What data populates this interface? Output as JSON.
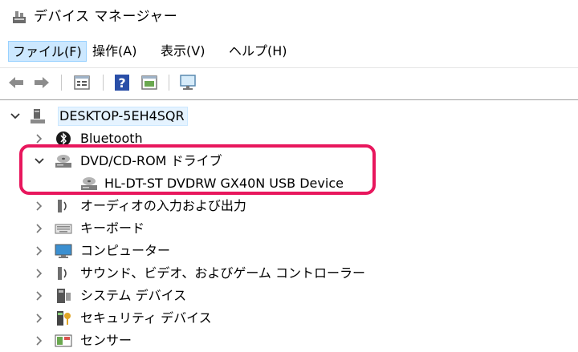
{
  "window": {
    "title": "デバイス マネージャー",
    "icon": "device-manager-icon"
  },
  "menu": [
    {
      "label": "ファイル(F)",
      "active": true
    },
    {
      "label": "操作(A)",
      "active": false
    },
    {
      "label": "表示(V)",
      "active": false
    },
    {
      "label": "ヘルプ(H)",
      "active": false
    }
  ],
  "toolbar": {
    "buttons": [
      "back-arrow-icon",
      "forward-arrow-icon",
      "properties-icon",
      "help-icon",
      "view-icon",
      "monitor-icon"
    ]
  },
  "tree": {
    "root": {
      "label": "DESKTOP-5EH4SQR",
      "expanded": true,
      "icon": "computer-tower-icon"
    },
    "items": [
      {
        "label": "Bluetooth",
        "icon": "bluetooth-icon",
        "expanded": false
      },
      {
        "label": "DVD/CD-ROM ドライブ",
        "icon": "optical-drive-icon",
        "expanded": true,
        "children": [
          {
            "label": "HL-DT-ST DVDRW  GX40N USB Device",
            "icon": "optical-drive-icon"
          }
        ]
      },
      {
        "label": "オーディオの入力および出力",
        "icon": "speaker-icon",
        "expanded": false
      },
      {
        "label": "キーボード",
        "icon": "keyboard-icon",
        "expanded": false
      },
      {
        "label": "コンピューター",
        "icon": "monitor-icon",
        "expanded": false
      },
      {
        "label": "サウンド、ビデオ、およびゲーム コントローラー",
        "icon": "speaker-icon",
        "expanded": false
      },
      {
        "label": "システム デバイス",
        "icon": "system-device-icon",
        "expanded": false
      },
      {
        "label": "セキュリティ デバイス",
        "icon": "security-key-icon",
        "expanded": false
      },
      {
        "label": "センサー",
        "icon": "sensor-icon",
        "expanded": false
      }
    ]
  },
  "annotation": {
    "color": "#e8175d"
  }
}
